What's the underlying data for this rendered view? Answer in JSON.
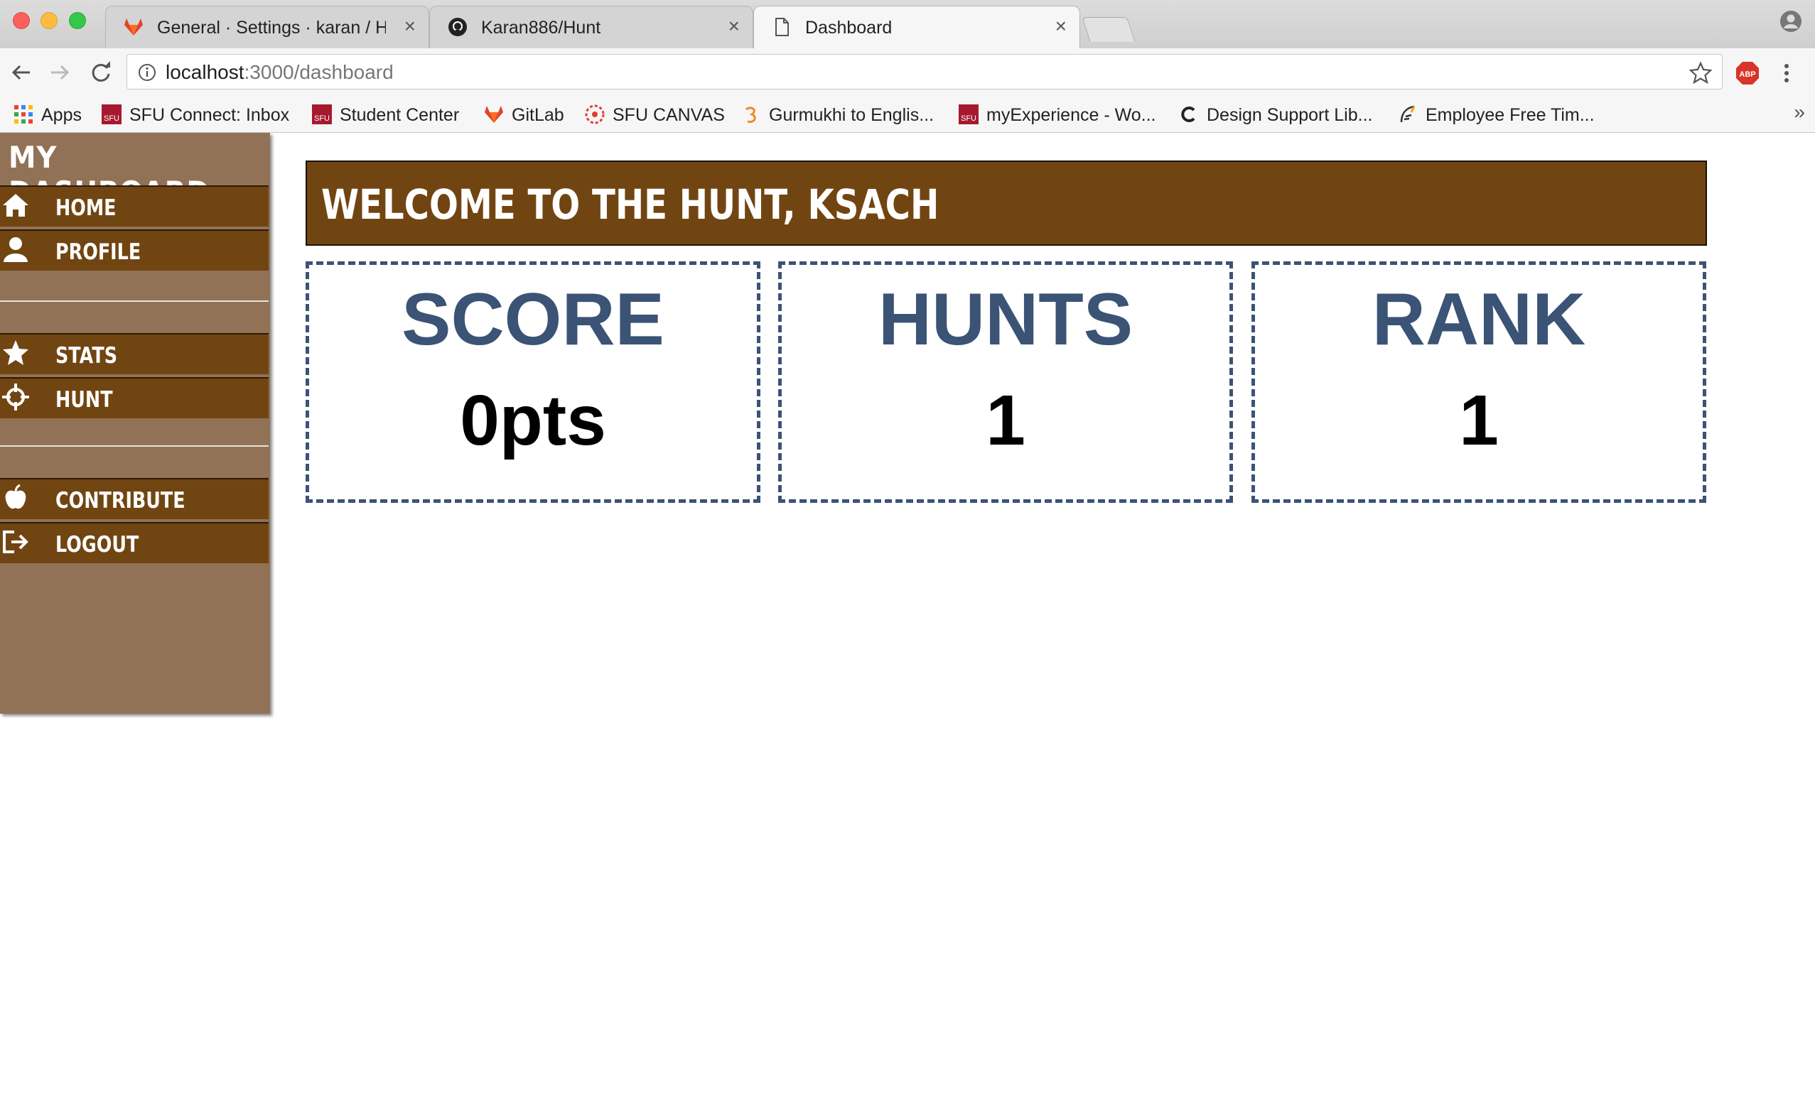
{
  "browser": {
    "tabs": [
      {
        "title": "General · Settings · karan / Hunt",
        "icon": "gitlab-icon",
        "active": false
      },
      {
        "title": "Karan886/Hunt",
        "icon": "github-icon",
        "active": false
      },
      {
        "title": "Dashboard",
        "icon": "page-icon",
        "active": true
      }
    ],
    "url_host": "localhost",
    "url_path": ":3000/dashboard",
    "bookmarks": [
      {
        "label": "Apps",
        "icon": "apps-grid-icon"
      },
      {
        "label": "SFU Connect: Inbox",
        "icon": "sfu-icon"
      },
      {
        "label": "Student Center",
        "icon": "sfu-icon"
      },
      {
        "label": "GitLab",
        "icon": "gitlab-icon"
      },
      {
        "label": "SFU CANVAS",
        "icon": "canvas-icon"
      },
      {
        "label": "Gurmukhi to Englis...",
        "icon": "gurmukhi-icon"
      },
      {
        "label": "myExperience - Wo...",
        "icon": "sfu-icon"
      },
      {
        "label": "Design Support Lib...",
        "icon": "c-icon"
      },
      {
        "label": "Employee Free Tim...",
        "icon": "feather-icon"
      }
    ],
    "bookmarks_more": "»"
  },
  "sidebar": {
    "title": "My Dashboard",
    "items": [
      {
        "label": "Home",
        "icon": "home-icon"
      },
      {
        "label": "Profile",
        "icon": "user-icon"
      },
      {
        "label": "Stats",
        "icon": "star-icon"
      },
      {
        "label": "Hunt",
        "icon": "crosshair-icon"
      },
      {
        "label": "Contribute",
        "icon": "apple-icon"
      },
      {
        "label": "Logout",
        "icon": "logout-icon"
      }
    ]
  },
  "main": {
    "welcome": "Welcome to the Hunt, ksach",
    "stats": [
      {
        "label": "SCORE",
        "value": "0pts"
      },
      {
        "label": "HUNTS",
        "value": "1"
      },
      {
        "label": "RANK",
        "value": "1"
      }
    ]
  },
  "colors": {
    "sidebar_bg": "#927256",
    "item_bg": "#714512",
    "card_border": "#3b5375",
    "card_label": "#3b5375"
  }
}
